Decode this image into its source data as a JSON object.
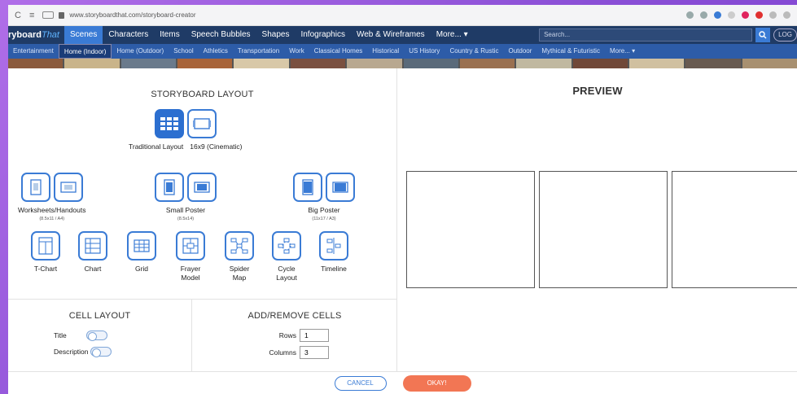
{
  "browser": {
    "url": "www.storyboardthat.com/storyboard-creator",
    "nav_icons": [
      "reload-icon",
      "menu-icon"
    ]
  },
  "site_nav": {
    "logo_main": "ryboard",
    "logo_that": "That",
    "items": [
      "Scenes",
      "Characters",
      "Items",
      "Speech Bubbles",
      "Shapes",
      "Infographics",
      "Web & Wireframes",
      "More... ▾"
    ],
    "search_placeholder": "Search...",
    "login": "LOG"
  },
  "categories": [
    "Entertainment",
    "Home (Indoor)",
    "Home (Outdoor)",
    "School",
    "Athletics",
    "Transportation",
    "Work",
    "Classical Homes",
    "Historical",
    "US History",
    "Country & Rustic",
    "Outdoor",
    "Mythical & Futuristic",
    "More... ▾"
  ],
  "storyboard_layout": {
    "title": "STORYBOARD LAYOUT",
    "traditional": "Traditional Layout",
    "cinematic": "16x9 (Cinematic)",
    "worksheets": "Worksheets/Handouts",
    "worksheets_sub": "(8.5x11 / A4)",
    "small_poster": "Small Poster",
    "small_poster_sub": "(8.5x14)",
    "big_poster": "Big Poster",
    "big_poster_sub": "(11x17 / A3)",
    "tchart": "T-Chart",
    "chart": "Chart",
    "grid": "Grid",
    "frayer": "Frayer\nModel",
    "spider": "Spider\nMap",
    "cycle": "Cycle\nLayout",
    "timeline": "Timeline"
  },
  "cell_layout": {
    "title": "CELL LAYOUT",
    "title_label": "Title",
    "description_label": "Description"
  },
  "add_remove": {
    "title": "ADD/REMOVE CELLS",
    "rows_label": "Rows",
    "rows_value": "1",
    "columns_label": "Columns",
    "columns_value": "3"
  },
  "preview": {
    "title": "PREVIEW"
  },
  "footer": {
    "cancel": "CANCEL",
    "okay": "OKAY!"
  },
  "colors": {
    "accent": "#3a7bd5",
    "okay": "#f27654",
    "nav": "#1f3b66",
    "category_bar": "#2d5ca8"
  }
}
